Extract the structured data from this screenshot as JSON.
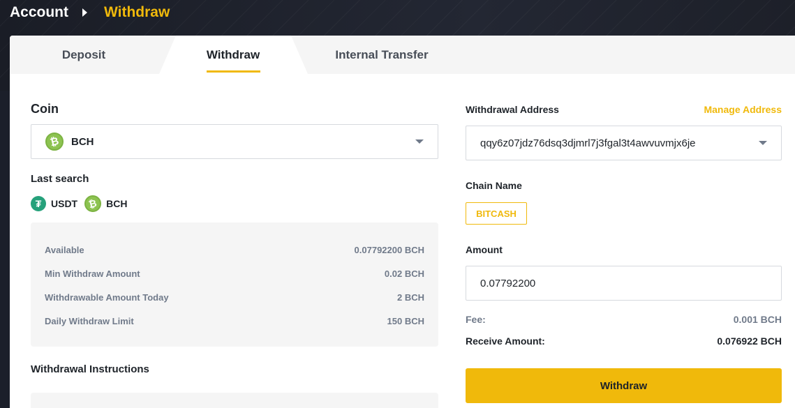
{
  "breadcrumb": {
    "parent": "Account",
    "current": "Withdraw"
  },
  "tabs": {
    "deposit": "Deposit",
    "withdraw": "Withdraw",
    "internal_transfer": "Internal Transfer",
    "active": "Withdraw"
  },
  "coin": {
    "label": "Coin",
    "selected": "BCH",
    "selected_icon": "bch-coin-icon"
  },
  "last_search": {
    "label": "Last search",
    "items": [
      {
        "symbol": "USDT",
        "icon": "usdt-coin-icon"
      },
      {
        "symbol": "BCH",
        "icon": "bch-coin-icon"
      }
    ]
  },
  "info": {
    "rows": [
      {
        "label": "Available",
        "value": "0.07792200 BCH"
      },
      {
        "label": "Min Withdraw Amount",
        "value": "0.02 BCH"
      },
      {
        "label": "Withdrawable Amount Today",
        "value": "2 BCH"
      },
      {
        "label": "Daily Withdraw Limit",
        "value": "150 BCH"
      }
    ]
  },
  "instructions": {
    "label": "Withdrawal Instructions"
  },
  "address": {
    "label": "Withdrawal Address",
    "manage_link": "Manage Address",
    "value": "qqy6z07jdz76dsq3djmrl7j3fgal3t4awvuvmjx6je"
  },
  "chain": {
    "label": "Chain Name",
    "value": "BITCASH"
  },
  "amount": {
    "label": "Amount",
    "value": "0.07792200"
  },
  "summary": {
    "fee_label": "Fee:",
    "fee_value": "0.001 BCH",
    "receive_label": "Receive Amount:",
    "receive_value": "0.076922 BCH"
  },
  "submit": {
    "label": "Withdraw"
  },
  "colors": {
    "accent": "#f0b90b",
    "bch_green": "#8dc351",
    "usdt_green": "#26a17b",
    "header_bg": "#1b1f2a"
  }
}
